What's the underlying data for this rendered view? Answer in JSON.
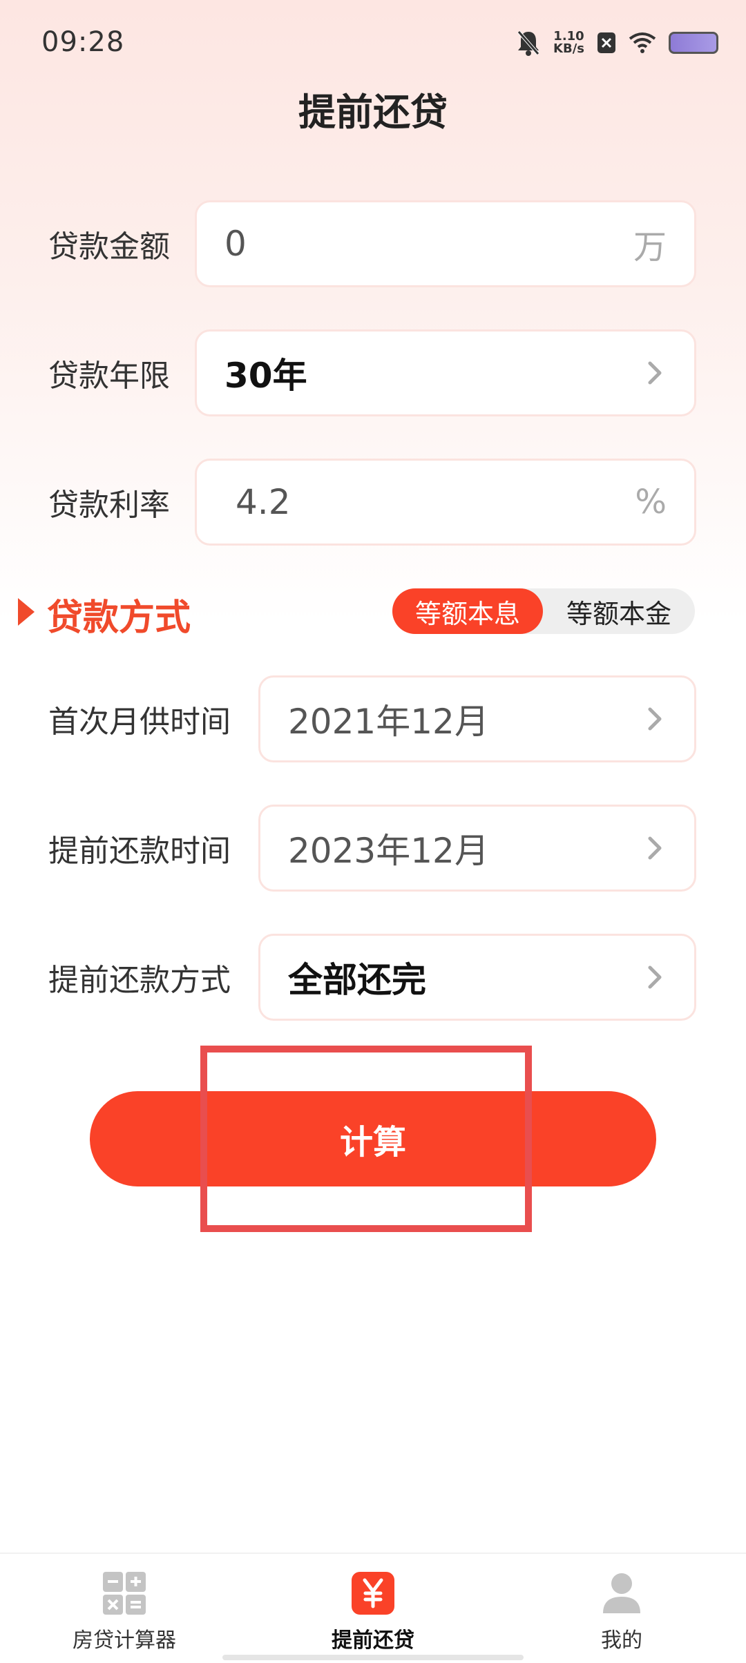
{
  "status_bar": {
    "time": "09:28",
    "speed_value": "1.10",
    "speed_unit": "KB/s"
  },
  "page": {
    "title": "提前还贷"
  },
  "form": {
    "loan_amount": {
      "label": "贷款金额",
      "value": "0",
      "unit": "万"
    },
    "loan_term": {
      "label": "贷款年限",
      "value": "30年"
    },
    "loan_rate": {
      "label": "贷款利率",
      "value": "4.2",
      "unit": "%"
    },
    "method": {
      "title": "贷款方式",
      "options": [
        "等额本息",
        "等额本金"
      ],
      "selected": "等额本息"
    },
    "first_payment": {
      "label": "首次月供时间",
      "value": "2021年12月"
    },
    "prepay_time": {
      "label": "提前还款时间",
      "value": "2023年12月"
    },
    "prepay_method": {
      "label": "提前还款方式",
      "value": "全部还完"
    }
  },
  "actions": {
    "calculate_label": "计算"
  },
  "tabbar": {
    "items": [
      {
        "label": "房贷计算器",
        "icon": "calculator-icon",
        "active": false
      },
      {
        "label": "提前还贷",
        "icon": "yuan-icon",
        "active": true
      },
      {
        "label": "我的",
        "icon": "person-icon",
        "active": false
      }
    ]
  },
  "colors": {
    "accent": "#fa4228",
    "title_red": "#f04a2b",
    "annotation": "#e94e4e"
  }
}
